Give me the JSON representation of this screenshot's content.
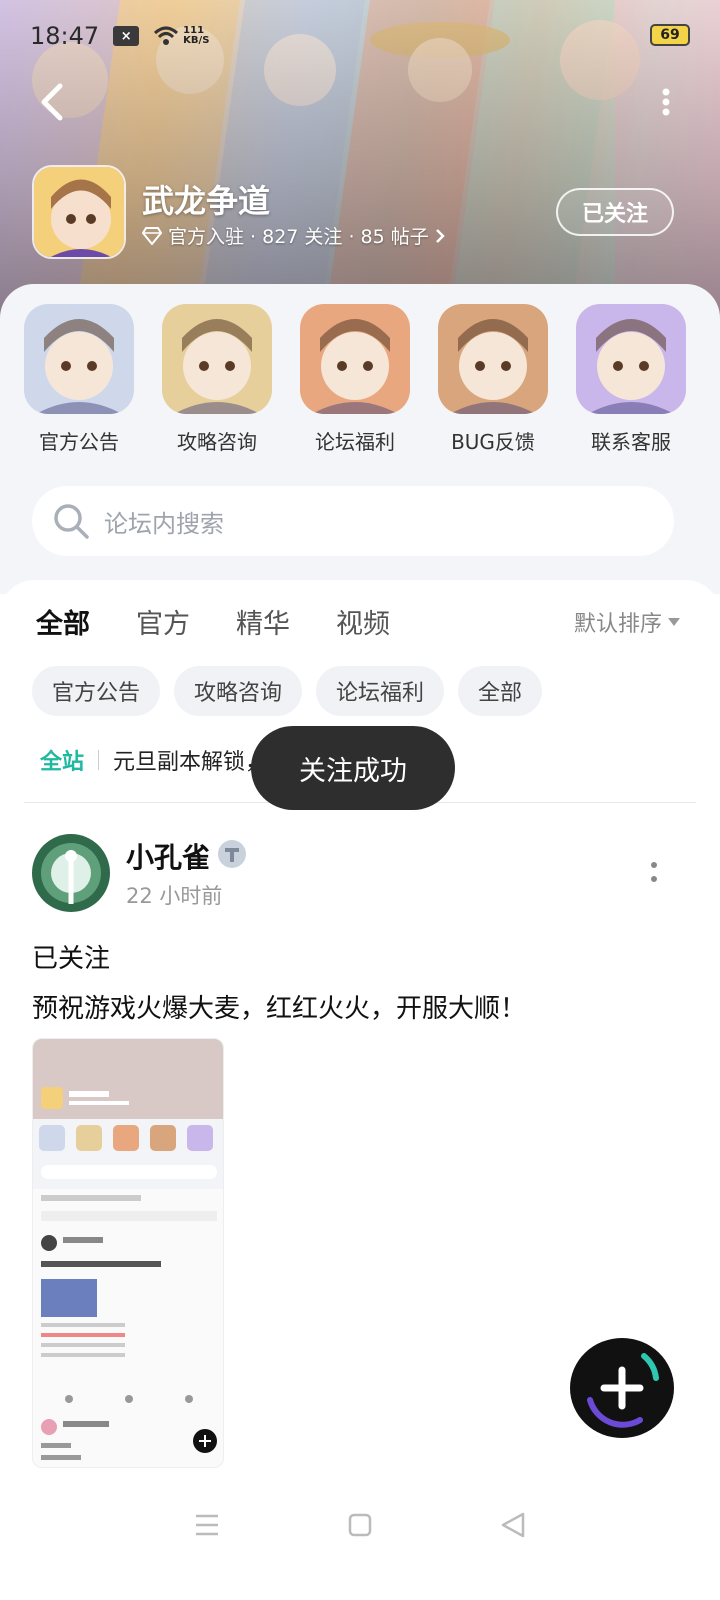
{
  "status_bar": {
    "time": "18:47",
    "notif_badge": "×",
    "speed_value": "111",
    "speed_unit": "KB/S",
    "battery": "69"
  },
  "header": {
    "game_name": "武龙争道",
    "meta": "官方入驻 · 827 关注 · 85 帖子",
    "follow_label": "已关注"
  },
  "quick_entries": [
    {
      "label": "官方公告",
      "color": "#cfd8ea"
    },
    {
      "label": "攻略咨询",
      "color": "#e7cf9c"
    },
    {
      "label": "论坛福利",
      "color": "#e9a77f"
    },
    {
      "label": "BUG反馈",
      "color": "#d9a57c"
    },
    {
      "label": "联系客服",
      "color": "#c9b6ea"
    }
  ],
  "search": {
    "placeholder": "论坛内搜索"
  },
  "tabs": [
    "全部",
    "官方",
    "精华",
    "视频"
  ],
  "sort_label": "默认排序",
  "chips": [
    "官方公告",
    "攻略咨询",
    "论坛福利",
    "全部"
  ],
  "notice": {
    "tag": "全站",
    "text": "元旦副本解锁，讨论活动等你来聊"
  },
  "toast": "关注成功",
  "post": {
    "author": "小孔雀",
    "time": "22 小时前",
    "line1": "已关注",
    "line2": "预祝游戏火爆大麦，红红火火，开服大顺！"
  },
  "colors": {
    "accent": "#29c3a6",
    "toast_bg": "#2e2e2e"
  }
}
